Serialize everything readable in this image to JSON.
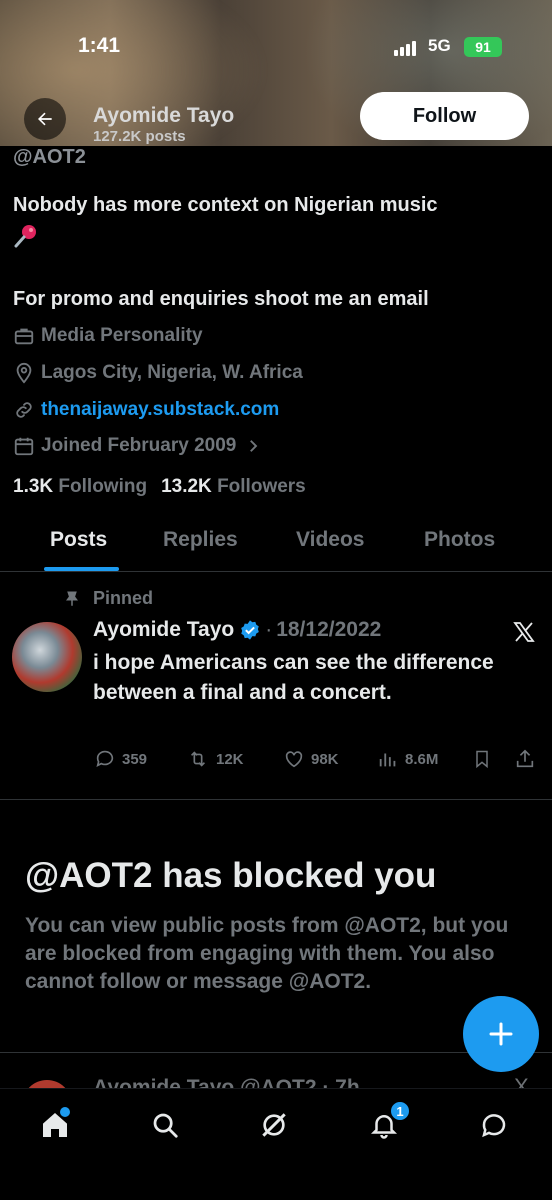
{
  "status_bar": {
    "time": "1:41",
    "network": "5G",
    "battery": "91"
  },
  "header": {
    "name": "Ayomide Tayo",
    "posts_count": "127.2K posts",
    "follow_label": "Follow"
  },
  "profile": {
    "handle": "@AOT2",
    "bio_line1": "Nobody has more context on Nigerian music",
    "bio_line2": "For promo and enquiries shoot me an email",
    "category": "Media Personality",
    "location": "Lagos City, Nigeria, W. Africa",
    "website": "thenaijaway.substack.com",
    "joined": "Joined February 2009",
    "following_count": "1.3K",
    "following_label": "Following",
    "followers_count": "13.2K",
    "followers_label": "Followers"
  },
  "tabs": [
    {
      "label": "Posts",
      "active": true
    },
    {
      "label": "Replies",
      "active": false
    },
    {
      "label": "Videos",
      "active": false
    },
    {
      "label": "Photos",
      "active": false
    }
  ],
  "pinned_post": {
    "pinned_label": "Pinned",
    "author": "Ayomide Tayo",
    "separator": "·",
    "date": "18/12/2022",
    "text": "i hope Americans can see the difference between a final and a concert.",
    "replies": "359",
    "reposts": "12K",
    "likes": "98K",
    "views": "8.6M"
  },
  "blocked": {
    "title": "@AOT2 has blocked you",
    "body": "You can view public posts from @AOT2, but you are blocked from engaging with them. You also cannot follow or message @AOT2."
  },
  "next_post_peek": {
    "text": "Ayomide Tayo  @AOT2 · 7h"
  },
  "bottom_nav": {
    "notifications_badge": "1"
  },
  "colors": {
    "accent": "#1d9bf0",
    "background": "#000000",
    "muted_text": "#71767b",
    "verified": "#1d9bf0"
  },
  "icons": [
    "back-arrow-icon",
    "briefcase-icon",
    "location-pin-icon",
    "link-icon",
    "calendar-icon",
    "chevron-right-icon",
    "pushpin-icon",
    "verified-badge-icon",
    "x-logo-icon",
    "reply-icon",
    "repost-icon",
    "like-icon",
    "views-icon",
    "bookmark-icon",
    "share-icon",
    "compose-plus-icon",
    "home-icon",
    "search-icon",
    "grok-icon",
    "notifications-bell-icon",
    "messages-icon"
  ]
}
